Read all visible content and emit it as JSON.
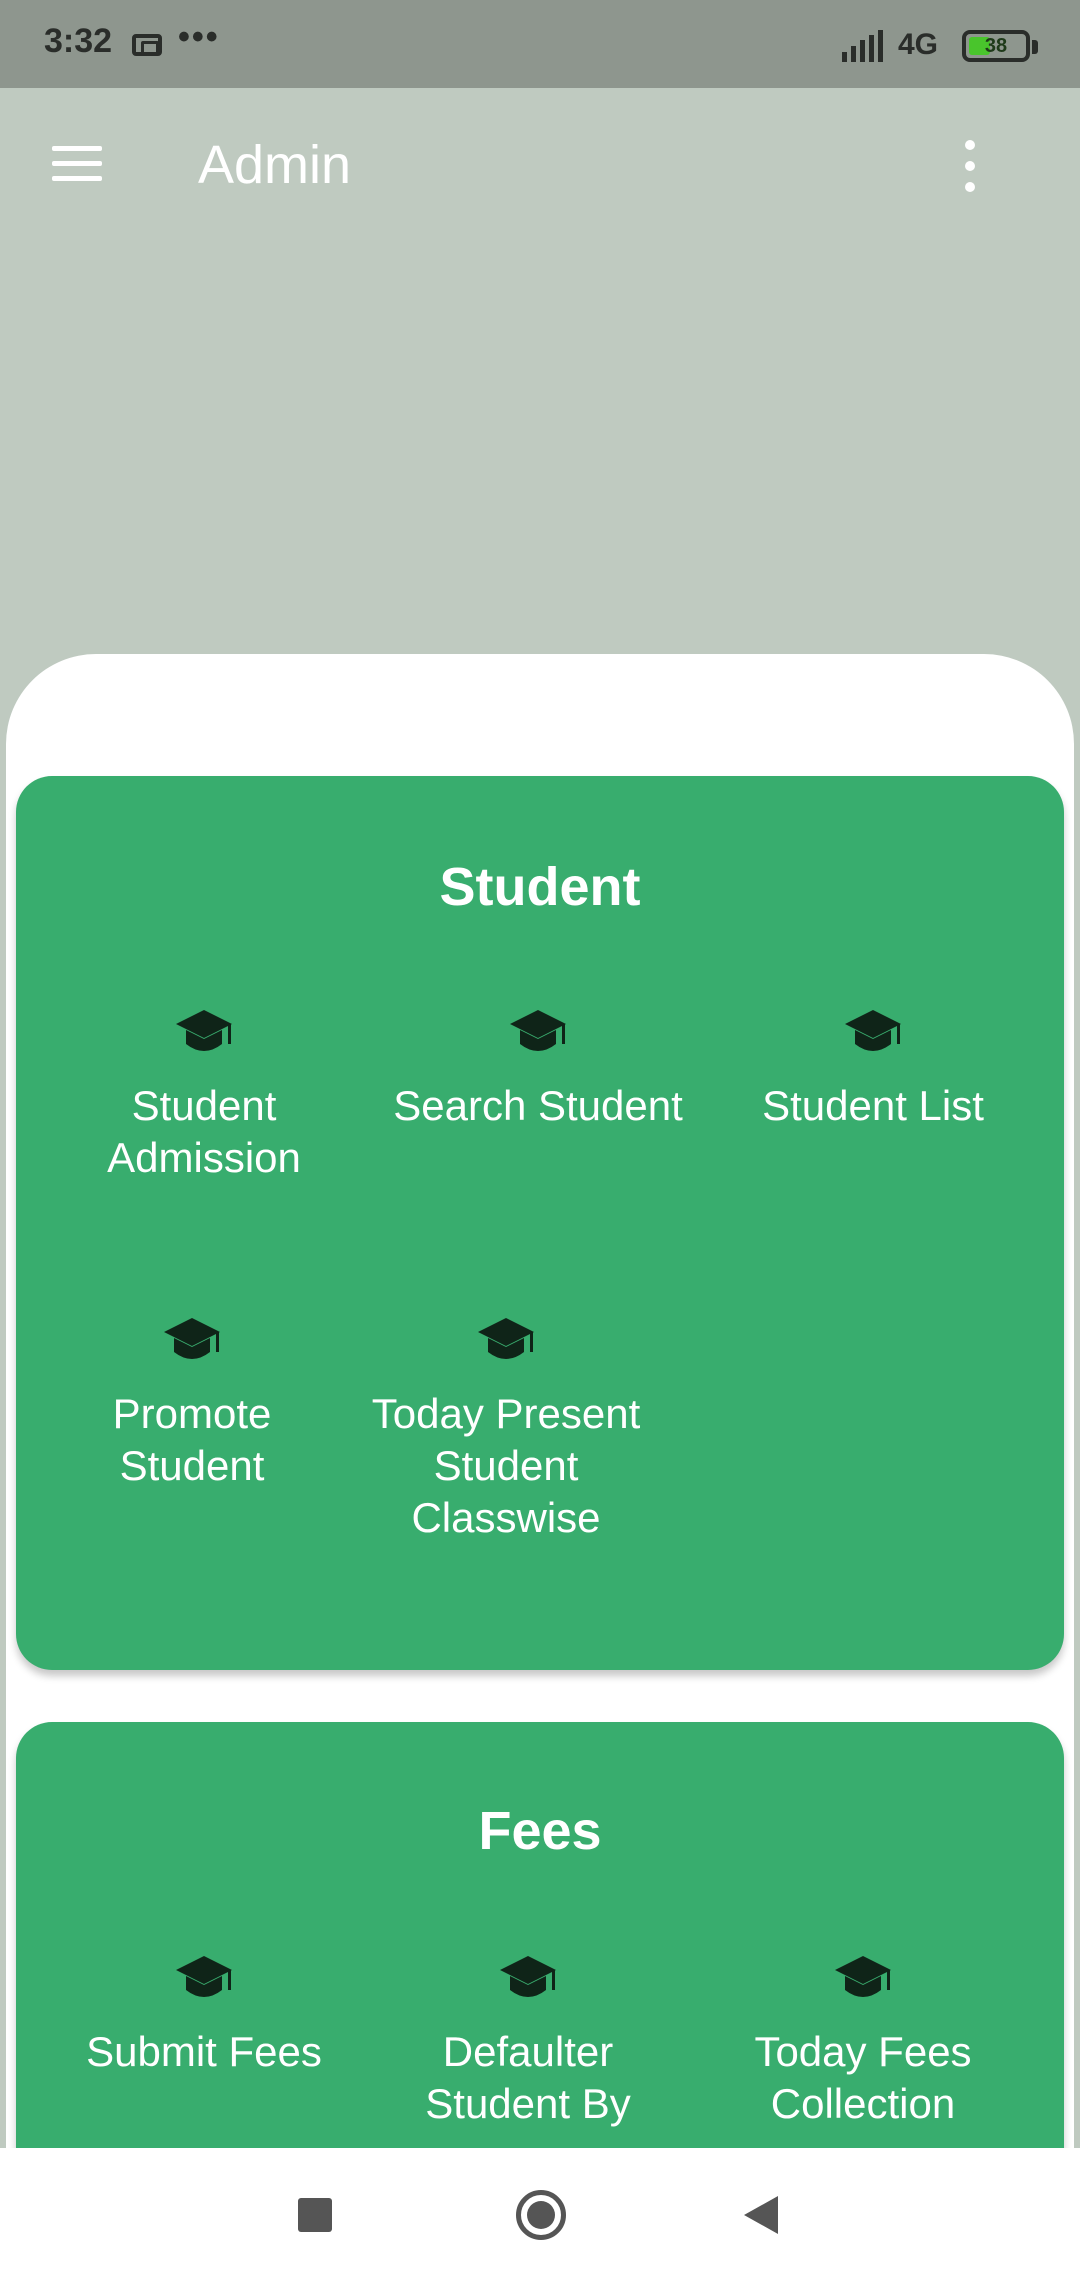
{
  "status_bar": {
    "time": "3:32",
    "network": "4G",
    "battery": "38",
    "battery_level": 0.38
  },
  "app_bar": {
    "title": "Admin",
    "menu_icon": "hamburger-menu-icon",
    "overflow_icon": "more-vertical-icon"
  },
  "sections": [
    {
      "title": "Student",
      "items": [
        {
          "label": "Student Admission",
          "icon": "graduation-cap-icon"
        },
        {
          "label": "Search Student",
          "icon": "graduation-cap-icon"
        },
        {
          "label": "Student List",
          "icon": "graduation-cap-icon"
        },
        {
          "label": "Promote Student",
          "icon": "graduation-cap-icon"
        },
        {
          "label": "Today Present Student Classwise",
          "icon": "graduation-cap-icon"
        }
      ]
    },
    {
      "title": "Fees",
      "items": [
        {
          "label": "Submit Fees",
          "icon": "graduation-cap-icon"
        },
        {
          "label": "Defaulter Student By",
          "icon": "graduation-cap-icon"
        },
        {
          "label": "Today Fees Collection",
          "icon": "graduation-cap-icon"
        }
      ]
    }
  ],
  "colors": {
    "header_bg": "#bfcac0",
    "card_bg": "#38ad6e",
    "icon": "#0f2418"
  },
  "nav_bar": {
    "recent_icon": "recent-apps-icon",
    "home_icon": "home-icon",
    "back_icon": "back-icon"
  }
}
